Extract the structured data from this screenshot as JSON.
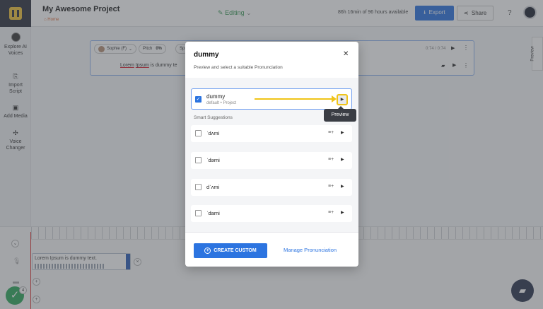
{
  "header": {
    "project_title": "My Awesome Project",
    "breadcrumb": "Home",
    "status": "Editing",
    "hours_available": "86h 16min of 96 hours available",
    "export_label": "Export",
    "share_label": "Share"
  },
  "sidebar": {
    "items": [
      {
        "label": "Explore AI\nVoices",
        "icon": "ai-voice-icon"
      },
      {
        "label": "Import\nScript",
        "icon": "import-icon"
      },
      {
        "label": "Add Media",
        "icon": "media-icon"
      },
      {
        "label": "Voice\nChanger",
        "icon": "voice-changer-icon"
      }
    ]
  },
  "editor": {
    "speaker": "Sophie (F)",
    "pitch_label": "Pitch",
    "pitch_value": "0%",
    "speed_label": "Sp",
    "time": "0:74 / 0:74",
    "text_part1": "Lorem",
    "text_part2": "Ipsum",
    "text_part3": "is dummy te"
  },
  "side_tab": {
    "label": "Preview"
  },
  "timeline": {
    "clip_text": "Lorem Ipsum is dummy text.",
    "done_count": "4"
  },
  "modal": {
    "title": "dummy",
    "subtitle": "Preview and select a suitable Pronunciation",
    "current": {
      "word": "dummy",
      "meta": "default • Project",
      "checked": true
    },
    "tooltip": "Preview",
    "smart_label": "Smart Suggestions",
    "suggestions": [
      {
        "word": "ˈdʌmi"
      },
      {
        "word": "ˈdəmi"
      },
      {
        "word": "dˈʌmi"
      },
      {
        "word": "ˈdami"
      }
    ],
    "create_label": "CREATE CUSTOM",
    "manage_label": "Manage Pronunciation"
  },
  "colors": {
    "accent": "#2c74e0",
    "highlight": "#f0c419",
    "success": "#2eaa5c",
    "logo_bg": "#2f3340"
  }
}
